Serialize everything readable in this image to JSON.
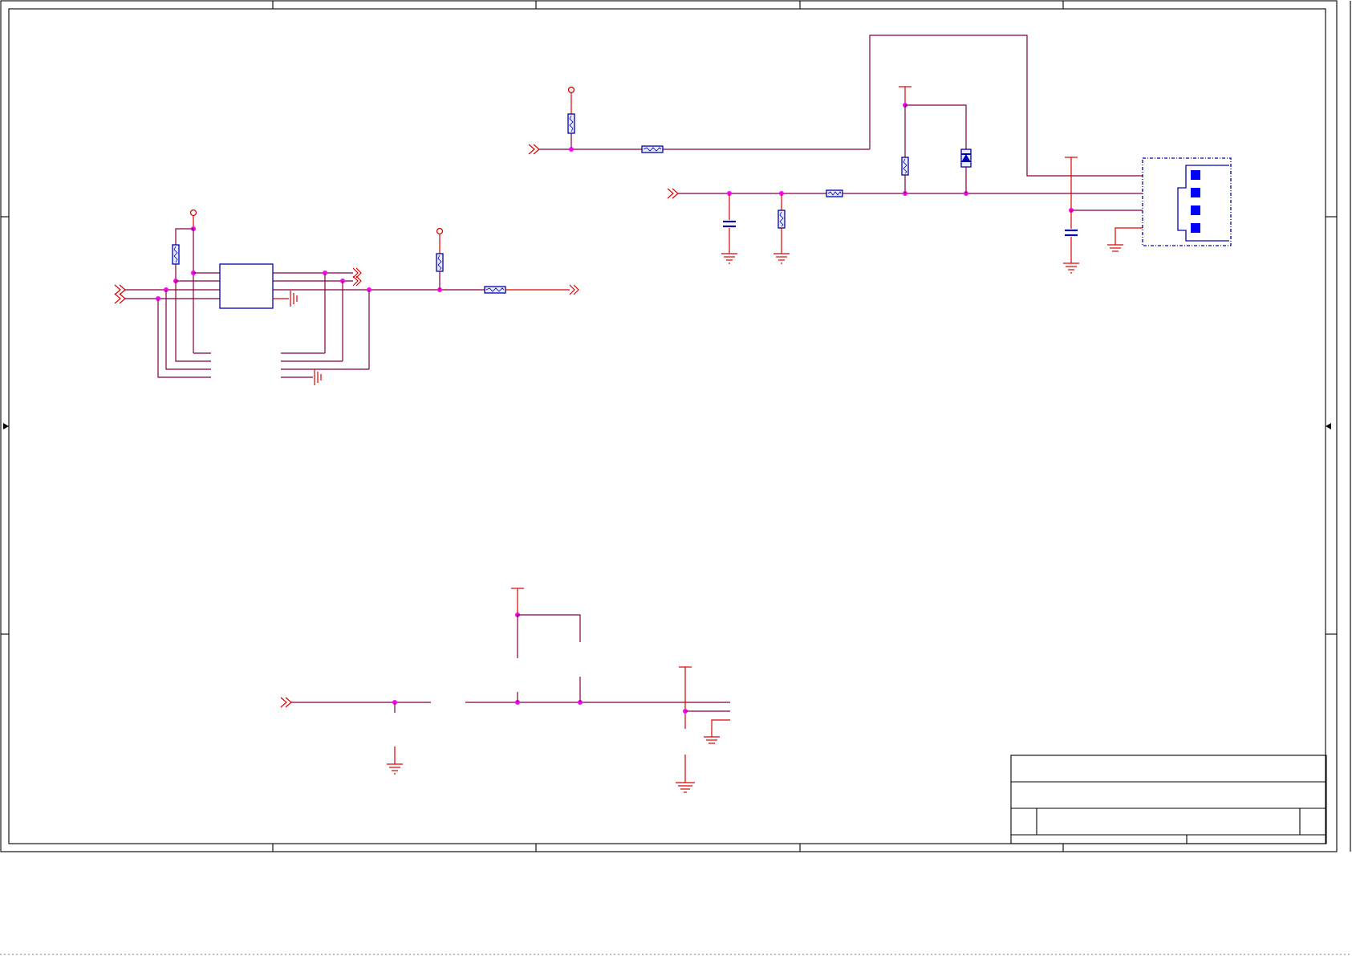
{
  "sheet": {
    "background": "#ffffff",
    "frame_color": "#000000",
    "wire_color": "#800040",
    "power_color": "#e00000",
    "component_color": "#0000b0",
    "junction_color": "#ff00ff"
  },
  "components": {
    "resistors": 8,
    "capacitors": 2,
    "diodes": 1,
    "ics": 1,
    "connectors": 1
  },
  "title_block": {
    "title": "",
    "sheet_label": ""
  }
}
